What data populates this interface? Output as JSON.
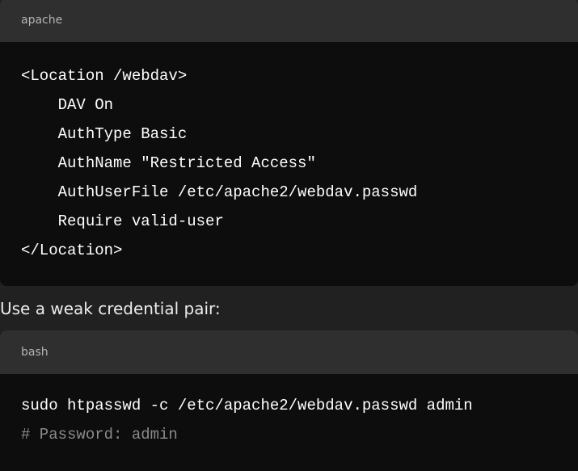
{
  "blocks": [
    {
      "language": "apache",
      "lines": [
        "<Location /webdav>",
        "    DAV On",
        "    AuthType Basic",
        "    AuthName \"Restricted Access\"",
        "    AuthUserFile /etc/apache2/webdav.passwd",
        "    Require valid-user",
        "</Location>"
      ]
    },
    {
      "language": "bash",
      "lines": [
        "sudo htpasswd -c /etc/apache2/webdav.passwd admin",
        "# Password: admin"
      ]
    }
  ],
  "prose": {
    "text": "Use a weak credential pair:"
  }
}
